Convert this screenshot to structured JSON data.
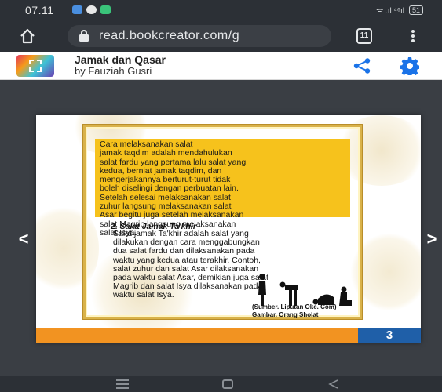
{
  "status_bar": {
    "time": "07.11",
    "signal_text": "ᯤ .ıl ⁴⁶ıl",
    "battery": "51"
  },
  "browser": {
    "url": "read.bookcreator.com/g",
    "tabs_count": "11"
  },
  "app_header": {
    "title": "Jamak dan Qasar",
    "author": "by Fauziah Gusri"
  },
  "page": {
    "yellow_box_lines": [
      "Cara melaksanakan salat",
      "jamak taqdim adalah mendahulukan",
      "salat fardu yang pertama lalu salat yang",
      "kedua, berniat jamak taqdim, dan",
      "mengerjakannya berturut-turut tidak",
      "boleh diselingi dengan perbuatan lain.",
      "Setelah selesai melaksanakan salat",
      "zuhur langsung melaksanakan salat",
      "Asar begitu juga setelah melaksanakan",
      "salat Magrib langsung melaksanakan",
      "salat Isya."
    ],
    "section_title": "2.  Salat Jamak Ta'khir",
    "section_lines": [
      "Salat jamak Ta'khir adalah salat yang",
      "dilakukan dengan cara menggabungkan",
      "dua salat fardu dan dilaksanakan pada",
      "waktu yang kedua atau terakhir. Contoh,",
      "salat zuhur dan salat Asar dilaksanakan",
      "pada waktu salat Asar, demikian juga salat",
      "Magrib dan salat Isya dilaksanakan pada",
      "waktu salat Isya."
    ],
    "caption_lines": [
      "(Sumber. Liputan Oke. Com)",
      "Gambar. Orang Sholat"
    ],
    "page_number": "3"
  },
  "nav": {
    "prev": "<",
    "next": ">"
  },
  "colors": {
    "accent_blue": "#1f5fa8",
    "orange": "#f29321",
    "yellow": "#f6c21c",
    "gold": "#d9b24a",
    "share_icon": "#1a73e8"
  },
  "icons": [
    "home-icon",
    "lock-icon",
    "tabs-icon",
    "menu-icon",
    "share-icon",
    "settings-icon",
    "prev-arrow-icon",
    "next-arrow-icon"
  ]
}
